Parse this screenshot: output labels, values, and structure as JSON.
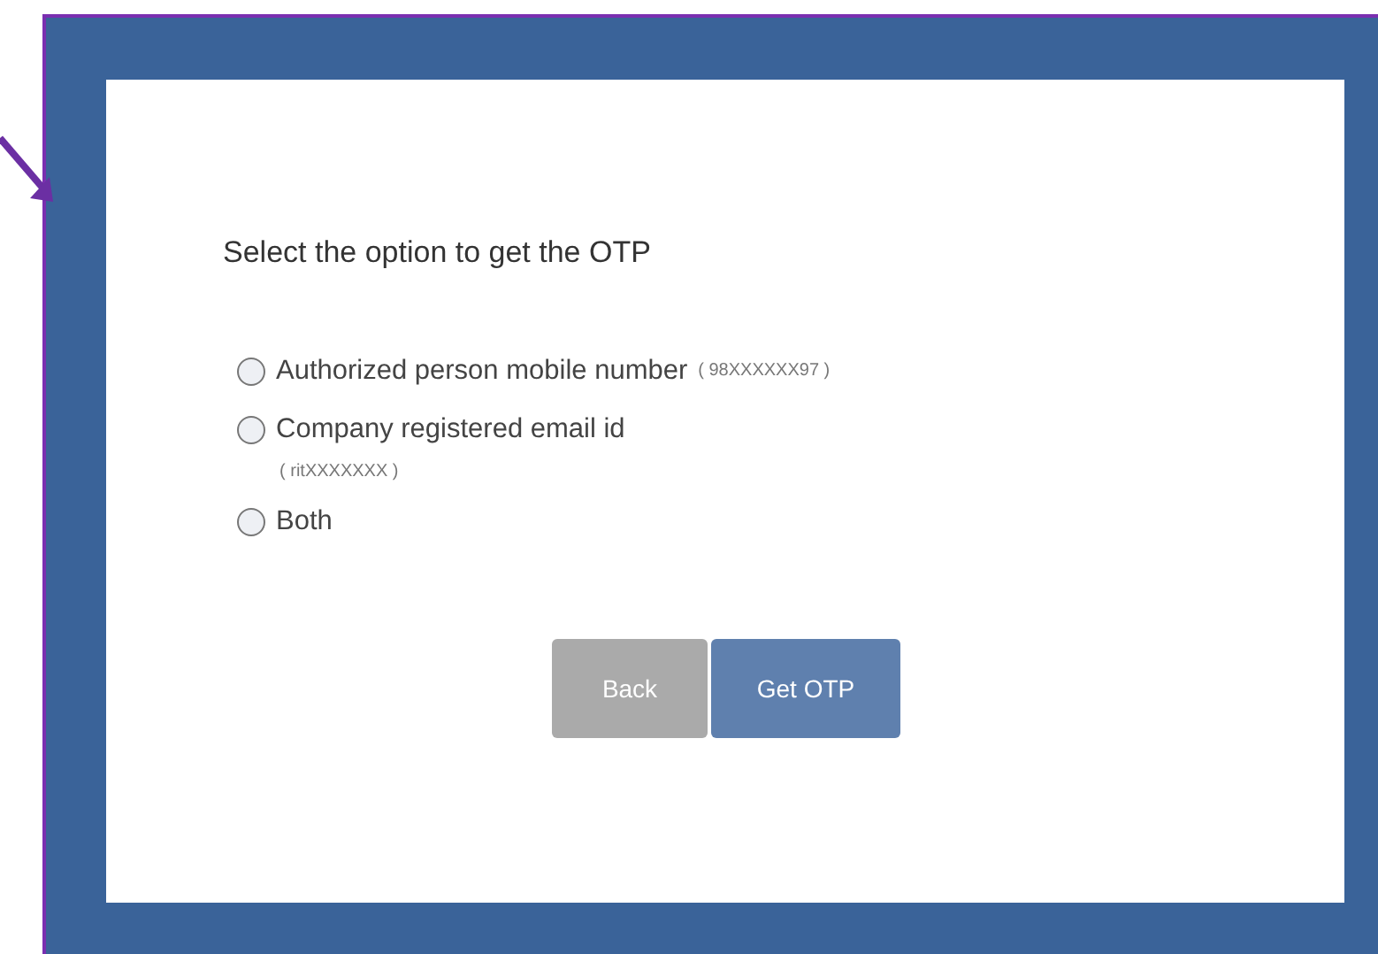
{
  "form": {
    "title": "Select the option to get the OTP",
    "options": [
      {
        "label": "Authorized person mobile number",
        "hint": "( 98XXXXXX97 )",
        "kind": "inline",
        "selected": false
      },
      {
        "label": "Company registered email id",
        "hint": "( ritXXXXXXX )",
        "kind": "below",
        "selected": false
      },
      {
        "label": "Both",
        "selected": false
      }
    ],
    "buttons": [
      {
        "label": "Back",
        "kind": "secondary"
      },
      {
        "label": "Get OTP",
        "kind": "primary"
      }
    ]
  }
}
